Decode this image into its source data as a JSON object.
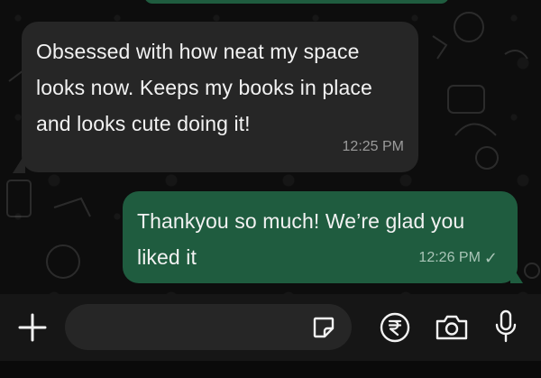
{
  "messages": [
    {
      "direction": "incoming",
      "text": "Obsessed with how neat my space looks now. Keeps my books in place and looks cute doing it!",
      "time": "12:25 PM"
    },
    {
      "direction": "outgoing",
      "text": "Thankyou so much! We’re glad you liked it",
      "time": "12:26 PM",
      "status": "✓"
    }
  ],
  "composer": {
    "placeholder": "",
    "icons": [
      "plus-icon",
      "sticker-icon",
      "rupee-icon",
      "camera-icon",
      "microphone-icon"
    ]
  },
  "colors": {
    "incoming_bubble": "#262626",
    "outgoing_bubble": "#1f5c3f",
    "background": "#0d0d0d"
  }
}
